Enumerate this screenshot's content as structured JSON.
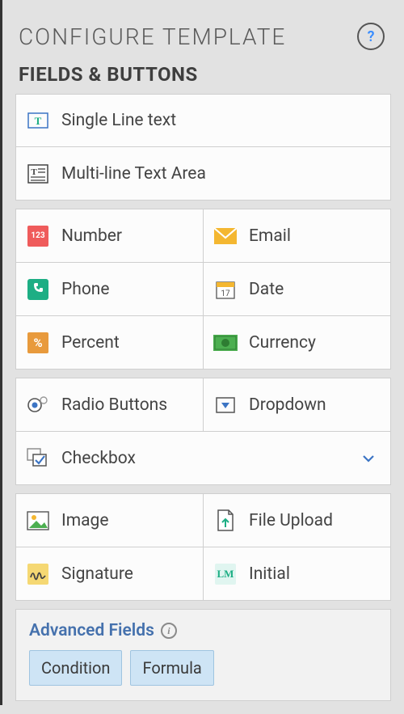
{
  "header": {
    "title": "CONFIGURE TEMPLATE",
    "help": "?"
  },
  "section": {
    "title": "FIELDS & BUTTONS"
  },
  "fields": {
    "singleLine": "Single Line text",
    "multiLine": "Multi-line Text Area",
    "number": "Number",
    "email": "Email",
    "phone": "Phone",
    "date": "Date",
    "dateDay": "17",
    "percent": "Percent",
    "currency": "Currency",
    "radio": "Radio Buttons",
    "dropdown": "Dropdown",
    "checkbox": "Checkbox",
    "image": "Image",
    "fileUpload": "File Upload",
    "signature": "Signature",
    "initial": "Initial",
    "initialGlyph": "LM",
    "numberGlyph": "123"
  },
  "advanced": {
    "title": "Advanced Fields",
    "info": "i",
    "condition": "Condition",
    "formula": "Formula"
  }
}
